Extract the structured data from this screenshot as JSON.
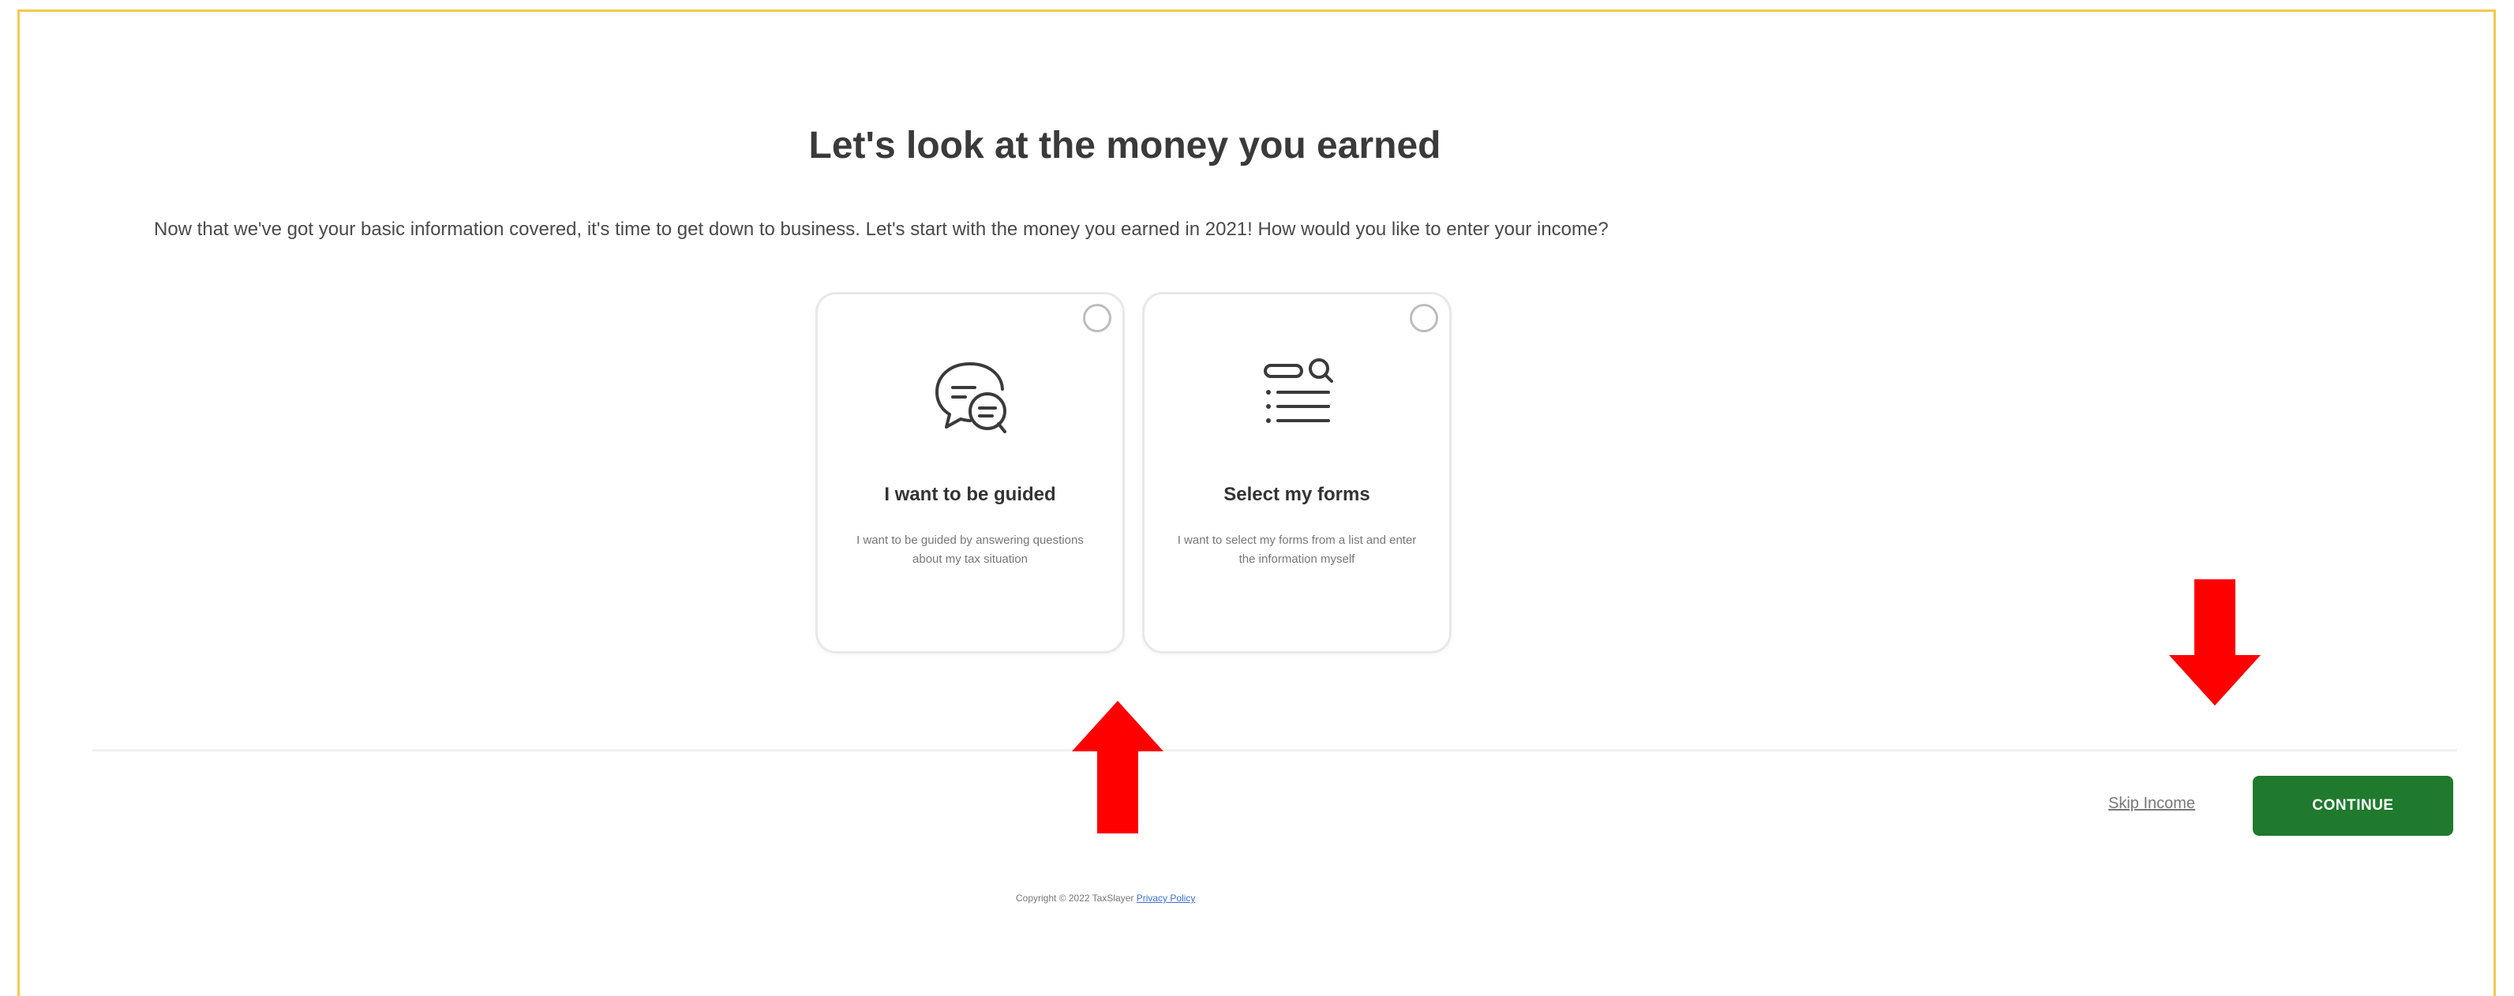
{
  "page": {
    "heading": "Let's look at the money you earned",
    "intro": "Now that we've got your basic information covered, it's time to get down to business. Let's start with the money you earned in 2021! How would you like to enter your income?"
  },
  "options": [
    {
      "title": "I want to be guided",
      "description": "I want to be guided by answering questions about my tax situation",
      "icon": "chat-bubbles-icon",
      "selected": false
    },
    {
      "title": "Select my forms",
      "description": "I want to select my forms from a list and enter the information myself",
      "icon": "list-search-icon",
      "selected": false
    }
  ],
  "actions": {
    "skip_label": "Skip Income",
    "continue_label": "CONTINUE"
  },
  "footer": {
    "copyright": "Copyright © 2022 TaxSlayer",
    "privacy_link": "Privacy Policy"
  },
  "annotations": {
    "arrow_color": "#ff0000"
  },
  "colors": {
    "frame_border": "#f2c94c",
    "primary_button": "#1f7a2d",
    "link": "#3b6fd6"
  }
}
